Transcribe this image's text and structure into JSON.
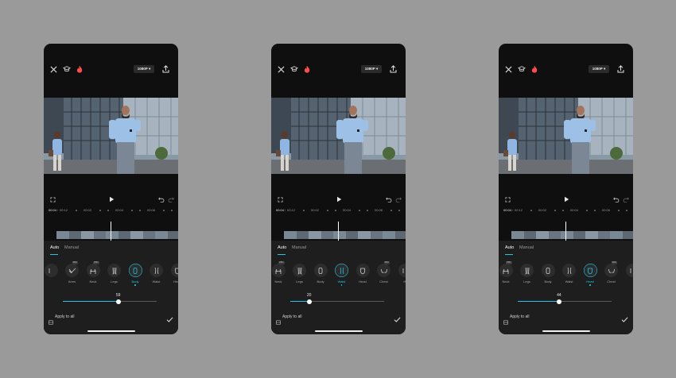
{
  "accent_color": "#22c3e6",
  "screens": [
    {
      "resolution_label": "1080P",
      "time_current": "00:04",
      "time_total": "00:12",
      "ruler_marks": [
        "00:02",
        "00:04",
        "00:06"
      ],
      "tabs": {
        "auto": "Auto",
        "manual": "Manual"
      },
      "tools": [
        {
          "label": "",
          "icon": "partial-icon",
          "pro": false,
          "selected": false
        },
        {
          "label": "Arms",
          "icon": "arms-icon",
          "pro": true,
          "selected": false
        },
        {
          "label": "Neck",
          "icon": "neck-icon",
          "pro": true,
          "selected": false
        },
        {
          "label": "Legs",
          "icon": "legs-icon",
          "pro": false,
          "selected": false
        },
        {
          "label": "Body",
          "icon": "body-icon",
          "pro": false,
          "selected": true
        },
        {
          "label": "Waist",
          "icon": "waist-icon",
          "pro": false,
          "selected": false
        },
        {
          "label": "Head",
          "icon": "head-icon",
          "pro": false,
          "selected": false
        }
      ],
      "slider": {
        "value": "59",
        "fraction": 0.59
      },
      "apply_label": "Apply to all"
    },
    {
      "resolution_label": "1080P",
      "time_current": "00:04",
      "time_total": "00:12",
      "ruler_marks": [
        "00:02",
        "00:04",
        "00:06"
      ],
      "tabs": {
        "auto": "Auto",
        "manual": "Manual"
      },
      "tools": [
        {
          "label": "Neck",
          "icon": "neck-icon",
          "pro": true,
          "selected": false
        },
        {
          "label": "Legs",
          "icon": "legs-icon",
          "pro": false,
          "selected": false
        },
        {
          "label": "Body",
          "icon": "body-icon",
          "pro": false,
          "selected": false
        },
        {
          "label": "Waist",
          "icon": "waist-icon",
          "pro": false,
          "selected": true
        },
        {
          "label": "Head",
          "icon": "head-icon",
          "pro": false,
          "selected": false
        },
        {
          "label": "Chest",
          "icon": "chest-icon",
          "pro": true,
          "selected": false
        },
        {
          "label": "H",
          "icon": "partial-icon",
          "pro": false,
          "selected": false
        }
      ],
      "slider": {
        "value": "20",
        "fraction": 0.2
      },
      "apply_label": "Apply to all"
    },
    {
      "resolution_label": "1080P",
      "time_current": "00:04",
      "time_total": "00:12",
      "ruler_marks": [
        "00:02",
        "00:04",
        "00:06"
      ],
      "tabs": {
        "auto": "Auto",
        "manual": "Manual"
      },
      "tools": [
        {
          "label": "Neck",
          "icon": "neck-icon",
          "pro": true,
          "selected": false
        },
        {
          "label": "Legs",
          "icon": "legs-icon",
          "pro": false,
          "selected": false
        },
        {
          "label": "Body",
          "icon": "body-icon",
          "pro": false,
          "selected": false
        },
        {
          "label": "Waist",
          "icon": "waist-icon",
          "pro": false,
          "selected": false
        },
        {
          "label": "Head",
          "icon": "head-icon",
          "pro": false,
          "selected": true
        },
        {
          "label": "Chest",
          "icon": "chest-icon",
          "pro": true,
          "selected": false
        },
        {
          "label": "",
          "icon": "partial-icon",
          "pro": false,
          "selected": false
        }
      ],
      "slider": {
        "value": "44",
        "fraction": 0.44
      },
      "apply_label": "Apply to all"
    }
  ]
}
